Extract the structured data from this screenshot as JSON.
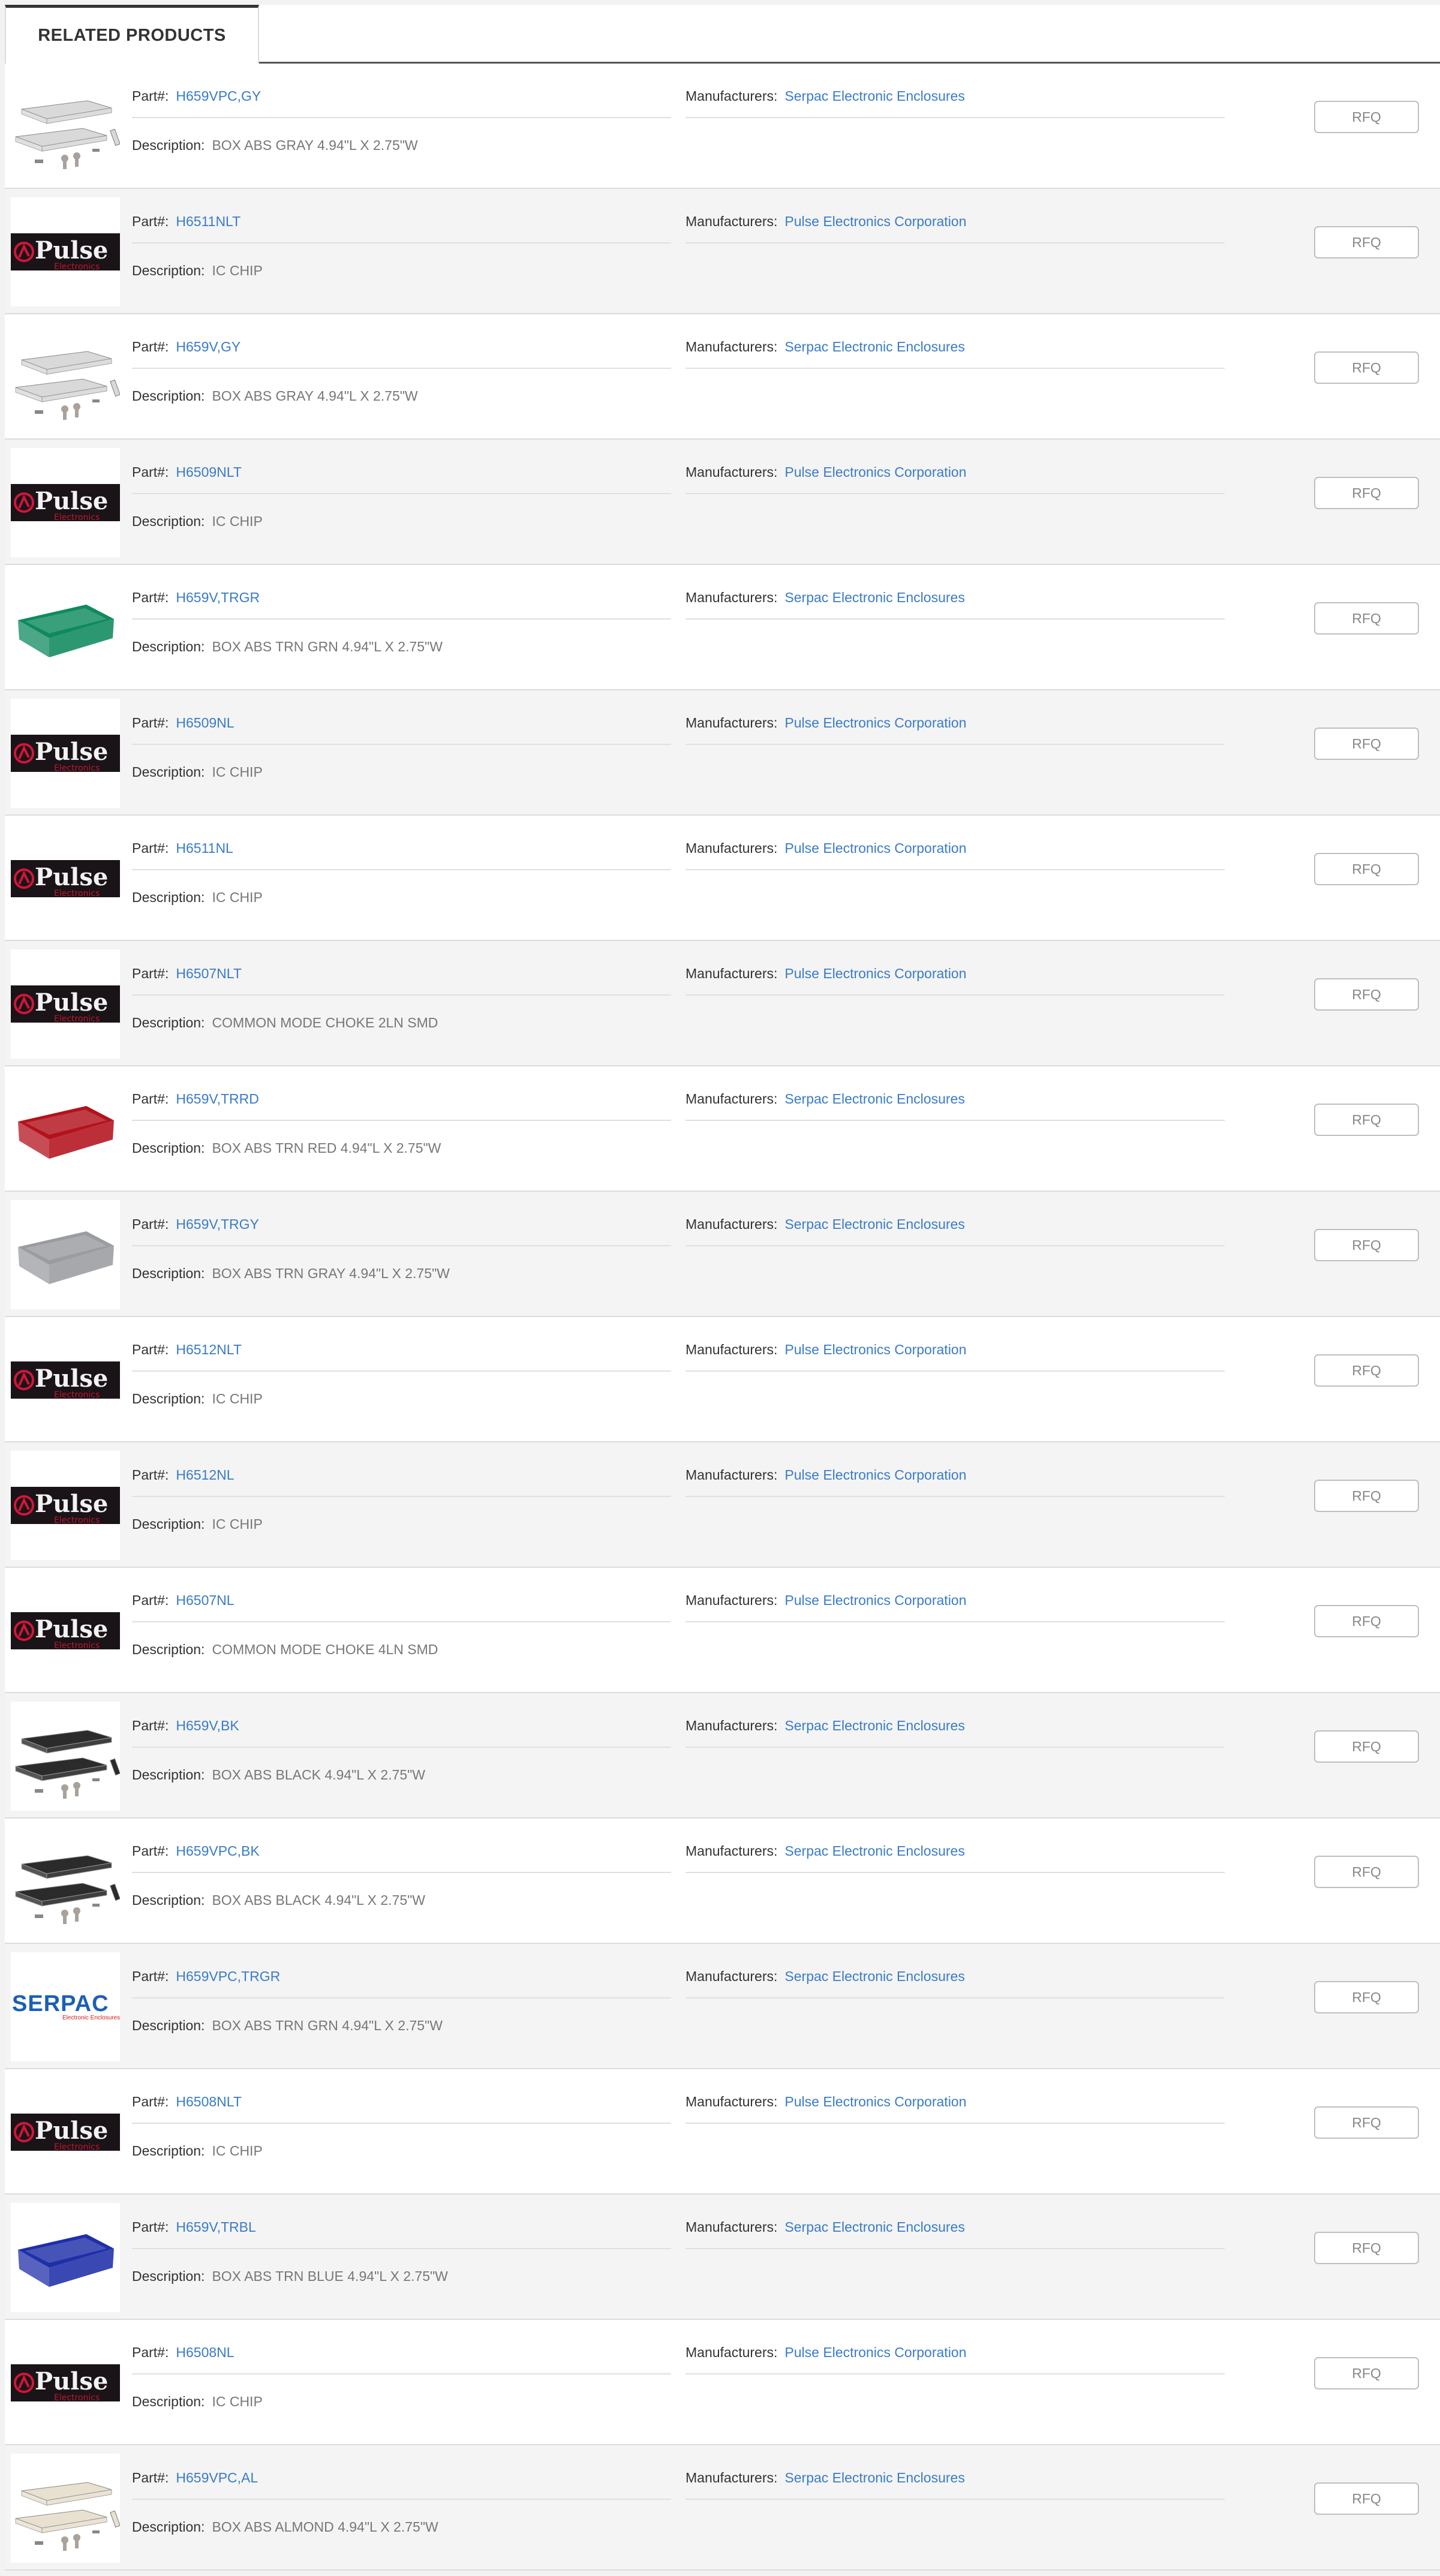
{
  "tab": {
    "label": "RELATED PRODUCTS"
  },
  "labels": {
    "part": "Part#:",
    "manufacturers": "Manufacturers:",
    "description": "Description:",
    "rfq": "RFQ"
  },
  "products": [
    {
      "part": "H659VPC,GY",
      "manufacturer": "Serpac Electronic Enclosures",
      "description": "BOX ABS GRAY 4.94\"L X 2.75\"W",
      "image": "enclosure-kit-gray-icon"
    },
    {
      "part": "H6511NLT",
      "manufacturer": "Pulse Electronics Corporation",
      "description": "IC CHIP",
      "image": "pulse-logo-icon"
    },
    {
      "part": "H659V,GY",
      "manufacturer": "Serpac Electronic Enclosures",
      "description": "BOX ABS GRAY 4.94\"L X 2.75\"W",
      "image": "enclosure-kit-gray-icon"
    },
    {
      "part": "H6509NLT",
      "manufacturer": "Pulse Electronics Corporation",
      "description": "IC CHIP",
      "image": "pulse-logo-icon"
    },
    {
      "part": "H659V,TRGR",
      "manufacturer": "Serpac Electronic Enclosures",
      "description": "BOX ABS TRN GRN 4.94\"L X 2.75\"W",
      "image": "enclosure-green-icon"
    },
    {
      "part": "H6509NL",
      "manufacturer": "Pulse Electronics Corporation",
      "description": "IC CHIP",
      "image": "pulse-logo-icon"
    },
    {
      "part": "H6511NL",
      "manufacturer": "Pulse Electronics Corporation",
      "description": "IC CHIP",
      "image": "pulse-logo-icon"
    },
    {
      "part": "H6507NLT",
      "manufacturer": "Pulse Electronics Corporation",
      "description": "COMMON MODE CHOKE 2LN SMD",
      "image": "pulse-logo-icon"
    },
    {
      "part": "H659V,TRRD",
      "manufacturer": "Serpac Electronic Enclosures",
      "description": "BOX ABS TRN RED 4.94\"L X 2.75\"W",
      "image": "enclosure-red-icon"
    },
    {
      "part": "H659V,TRGY",
      "manufacturer": "Serpac Electronic Enclosures",
      "description": "BOX ABS TRN GRAY 4.94\"L X 2.75\"W",
      "image": "enclosure-gray-icon"
    },
    {
      "part": "H6512NLT",
      "manufacturer": "Pulse Electronics Corporation",
      "description": "IC CHIP",
      "image": "pulse-logo-icon"
    },
    {
      "part": "H6512NL",
      "manufacturer": "Pulse Electronics Corporation",
      "description": "IC CHIP",
      "image": "pulse-logo-icon"
    },
    {
      "part": "H6507NL",
      "manufacturer": "Pulse Electronics Corporation",
      "description": "COMMON MODE CHOKE 4LN SMD",
      "image": "pulse-logo-icon"
    },
    {
      "part": "H659V,BK",
      "manufacturer": "Serpac Electronic Enclosures",
      "description": "BOX ABS BLACK 4.94\"L X 2.75\"W",
      "image": "enclosure-kit-black-icon"
    },
    {
      "part": "H659VPC,BK",
      "manufacturer": "Serpac Electronic Enclosures",
      "description": "BOX ABS BLACK 4.94\"L X 2.75\"W",
      "image": "enclosure-kit-black-icon"
    },
    {
      "part": "H659VPC,TRGR",
      "manufacturer": "Serpac Electronic Enclosures",
      "description": "BOX ABS TRN GRN 4.94\"L X 2.75\"W",
      "image": "serpac-logo-icon"
    },
    {
      "part": "H6508NLT",
      "manufacturer": "Pulse Electronics Corporation",
      "description": "IC CHIP",
      "image": "pulse-logo-icon"
    },
    {
      "part": "H659V,TRBL",
      "manufacturer": "Serpac Electronic Enclosures",
      "description": "BOX ABS TRN BLUE 4.94\"L X 2.75\"W",
      "image": "enclosure-blue-icon"
    },
    {
      "part": "H6508NL",
      "manufacturer": "Pulse Electronics Corporation",
      "description": "IC CHIP",
      "image": "pulse-logo-icon"
    },
    {
      "part": "H659VPC,AL",
      "manufacturer": "Serpac Electronic Enclosures",
      "description": "BOX ABS ALMOND 4.94\"L X 2.75\"W",
      "image": "enclosure-kit-almond-icon"
    }
  ],
  "logo_text": {
    "pulse": "Pulse",
    "pulse_sub": "Electronics",
    "serpac": "SERPAC",
    "serpac_sub": "Electronic Enclosures"
  },
  "colors": {
    "link": "#3a7bc8",
    "green": "#0f8a5f",
    "red": "#b3121c",
    "gray": "#9a9ca0",
    "blue": "#1f2fa8",
    "black": "#2b2b2b",
    "lightgray": "#d9d9d9",
    "almond": "#e8e1cf"
  }
}
